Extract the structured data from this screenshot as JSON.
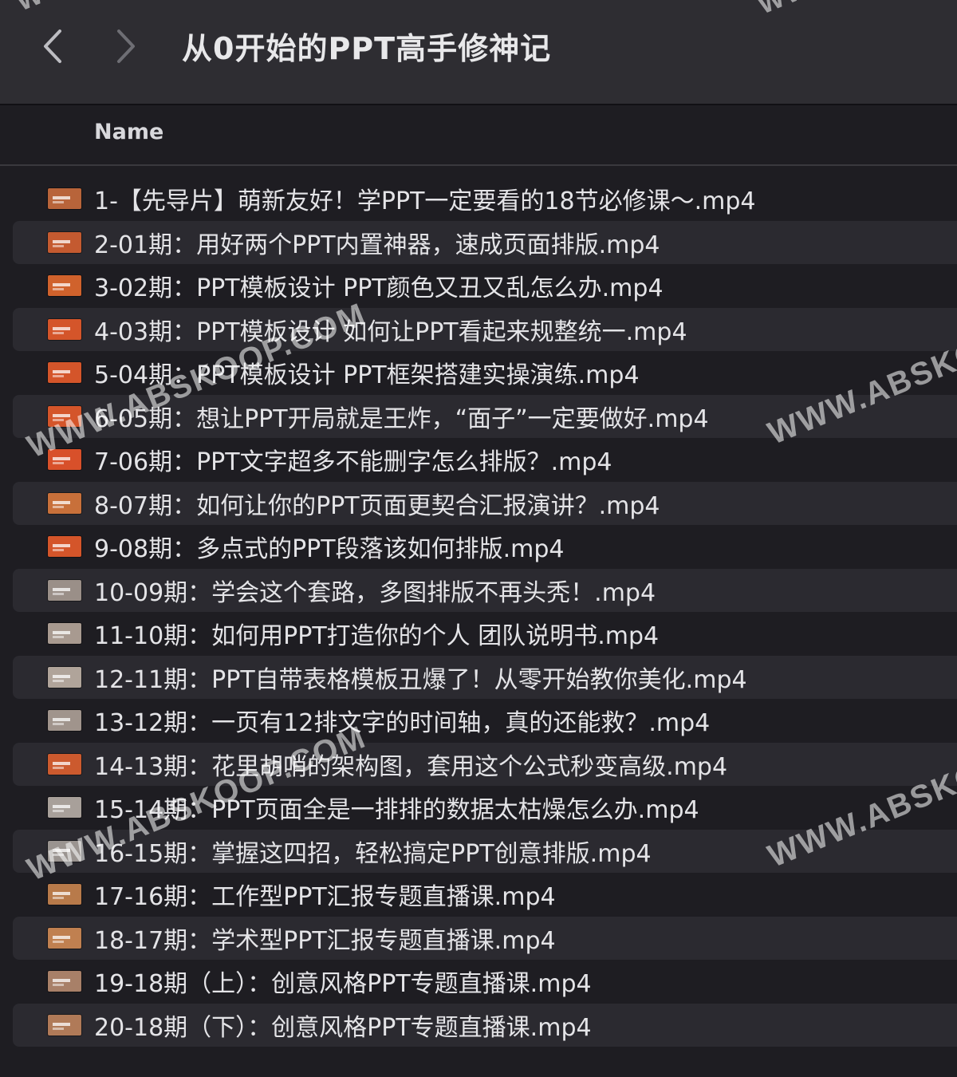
{
  "window": {
    "title": "从0开始的PPT高手修神记"
  },
  "columns": {
    "name": "Name"
  },
  "files": [
    {
      "name": "1-【先导片】萌新友好！学PPT一定要看的18节必修课～.mp4",
      "thumb_color": "#b8643a"
    },
    {
      "name": "2-01期：用好两个PPT内置神器，速成页面排版.mp4",
      "thumb_color": "#c45a30"
    },
    {
      "name": "3-02期：PPT模板设计   PPT颜色又丑又乱怎么办.mp4",
      "thumb_color": "#d0622c"
    },
    {
      "name": "4-03期：PPT模板设计   如何让PPT看起来规整统一.mp4",
      "thumb_color": "#d4552a"
    },
    {
      "name": "5-04期：PPT模板设计   PPT框架搭建实操演练.mp4",
      "thumb_color": "#d4552a"
    },
    {
      "name": "6-05期：想让PPT开局就是王炸，“面子”一定要做好.mp4",
      "thumb_color": "#d4552a"
    },
    {
      "name": "7-06期：PPT文字超多不能删字怎么排版？.mp4",
      "thumb_color": "#d8502a"
    },
    {
      "name": "8-07期：如何让你的PPT页面更契合汇报演讲？.mp4",
      "thumb_color": "#c8703a"
    },
    {
      "name": "9-08期：多点式的PPT段落该如何排版.mp4",
      "thumb_color": "#d4552a"
    },
    {
      "name": "10-09期：学会这个套路，多图排版不再头秃！.mp4",
      "thumb_color": "#9a8f88"
    },
    {
      "name": "11-10期：如何用PPT打造你的个人 团队说明书.mp4",
      "thumb_color": "#a89a90"
    },
    {
      "name": "12-11期：PPT自带表格模板丑爆了！从零开始教你美化.mp4",
      "thumb_color": "#b0a49a"
    },
    {
      "name": "13-12期：一页有12排文字的时间轴，真的还能救？.mp4",
      "thumb_color": "#a0948c"
    },
    {
      "name": "14-13期：花里胡哨的架构图，套用这个公式秒变高级.mp4",
      "thumb_color": "#cc5a2e"
    },
    {
      "name": "15-14期：PPT页面全是一排排的数据太枯燥怎么办.mp4",
      "thumb_color": "#a8a09a"
    },
    {
      "name": "16-15期：掌握这四招，轻松搞定PPT创意排版.mp4",
      "thumb_color": "#9a9490"
    },
    {
      "name": "17-16期：工作型PPT汇报专题直播课.mp4",
      "thumb_color": "#b87a4a"
    },
    {
      "name": "18-17期：学术型PPT汇报专题直播课.mp4",
      "thumb_color": "#c08050"
    },
    {
      "name": "19-18期（上）：创意风格PPT专题直播课.mp4",
      "thumb_color": "#a88068"
    },
    {
      "name": "20-18期（下）：创意风格PPT专题直播课.mp4",
      "thumb_color": "#b07a58"
    }
  ],
  "watermark": {
    "text": "WWW.ABSKOOP.COM",
    "text_short": "WWW.ABSKO",
    "text_top": "WW"
  },
  "colors": {
    "toolbar_bg": "#2e2d32",
    "list_bg": "#1e1d22",
    "alt_row_bg": "#2b2a30",
    "text": "#e4e4e7"
  },
  "icons": {
    "back": "chevron-left-icon",
    "forward": "chevron-right-icon",
    "file": "video-thumbnail-icon"
  }
}
